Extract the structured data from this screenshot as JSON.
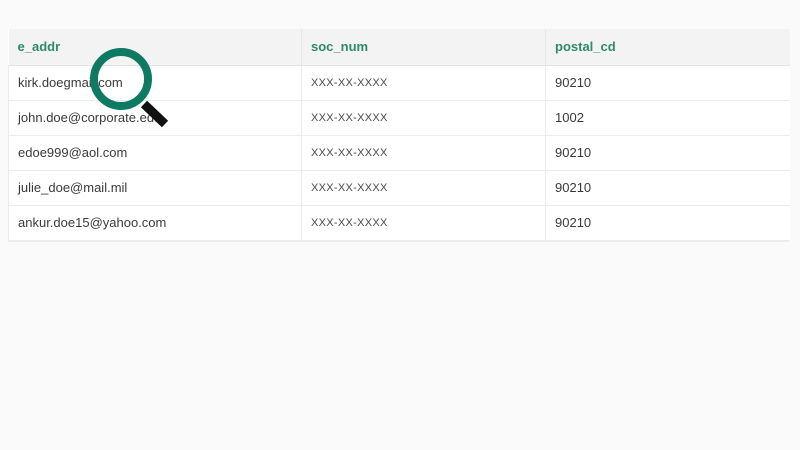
{
  "table": {
    "columns": [
      "e_addr",
      "soc_num",
      "postal_cd"
    ],
    "rows": [
      {
        "e_addr": "kirk.doegmail.com",
        "soc_num": "XXX-XX-XXXX",
        "postal_cd": "90210"
      },
      {
        "e_addr": "john.doe@corporate.edu",
        "soc_num": "XXX-XX-XXXX",
        "postal_cd": "1002"
      },
      {
        "e_addr": "edoe999@aol.com",
        "soc_num": "XXX-XX-XXXX",
        "postal_cd": "90210"
      },
      {
        "e_addr": "julie_doe@mail.mil",
        "soc_num": "XXX-XX-XXXX",
        "postal_cd": "90210"
      },
      {
        "e_addr": "ankur.doe15@yahoo.com",
        "soc_num": "XXX-XX-XXXX",
        "postal_cd": "90210"
      }
    ]
  },
  "overlay": {
    "icon": "magnifier-icon",
    "ring_color": "#0f7a62",
    "handle_color": "#111111"
  },
  "colors": {
    "header_text": "#2f8a6a",
    "header_bg": "#f3f3f4",
    "page_bg": "#fbfafb"
  }
}
